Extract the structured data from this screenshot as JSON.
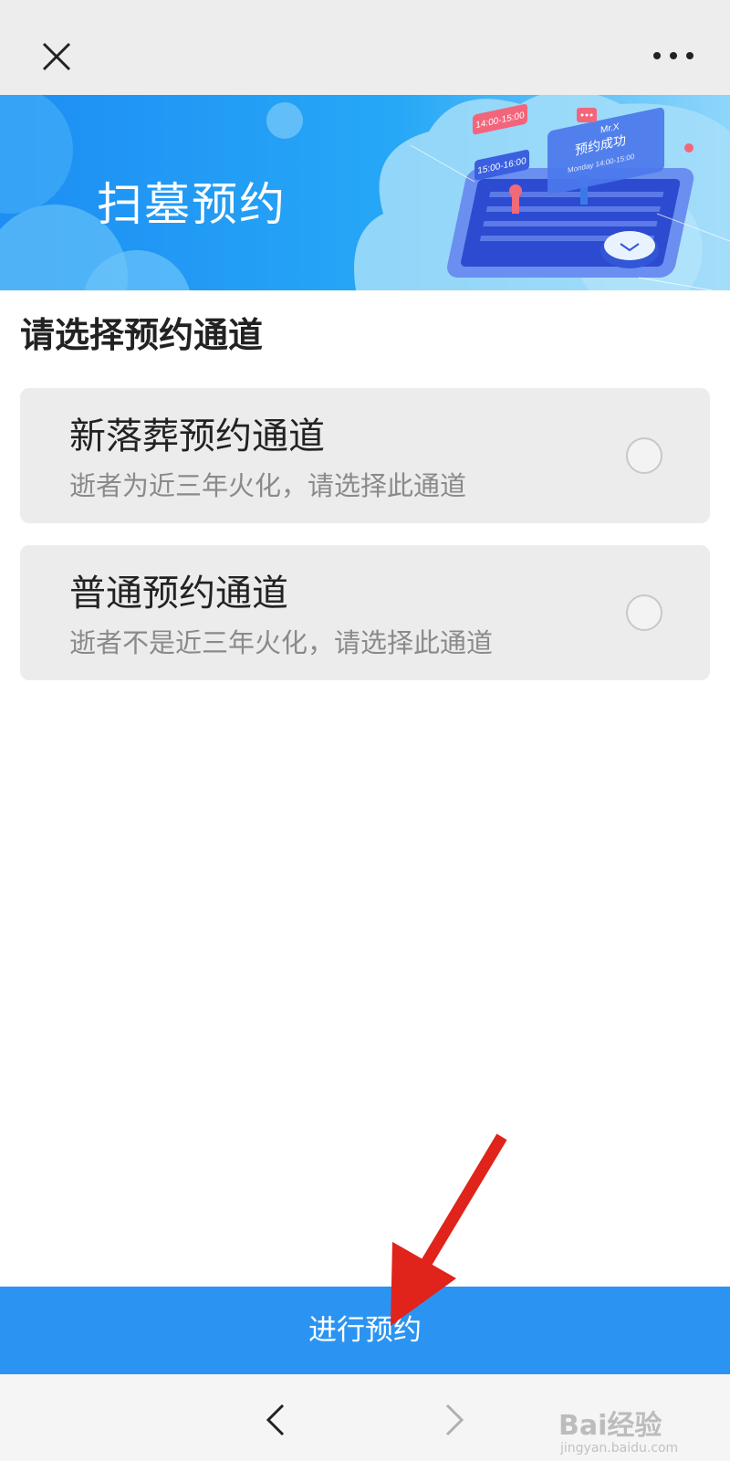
{
  "topbar": {
    "close_icon": "close-icon",
    "more_icon": "more-dots-icon"
  },
  "banner": {
    "title": "扫墓预约",
    "illustration": {
      "time_tag_1": "14:00-15:00",
      "time_tag_2": "15:00-16:00",
      "card_name": "Mr.X",
      "card_status": "预约成功",
      "card_detail": "Monday 14:00-15:00"
    },
    "colors": {
      "start": "#1e90f5",
      "end": "#8fd6fb"
    }
  },
  "main": {
    "heading": "请选择预约通道",
    "options": [
      {
        "title": "新落葬预约通道",
        "desc": "逝者为近三年火化，请选择此通道",
        "selected": false
      },
      {
        "title": "普通预约通道",
        "desc": "逝者不是近三年火化，请选择此通道",
        "selected": false
      }
    ]
  },
  "submit": {
    "label": "进行预约",
    "color": "#2b94f3"
  },
  "bottom_nav": {
    "back_icon": "chevron-left-icon",
    "forward_icon": "chevron-right-icon"
  },
  "annotation": {
    "color": "#e0231b"
  },
  "watermark": {
    "brand": "Bai经验",
    "url": "jingyan.baidu.com"
  }
}
